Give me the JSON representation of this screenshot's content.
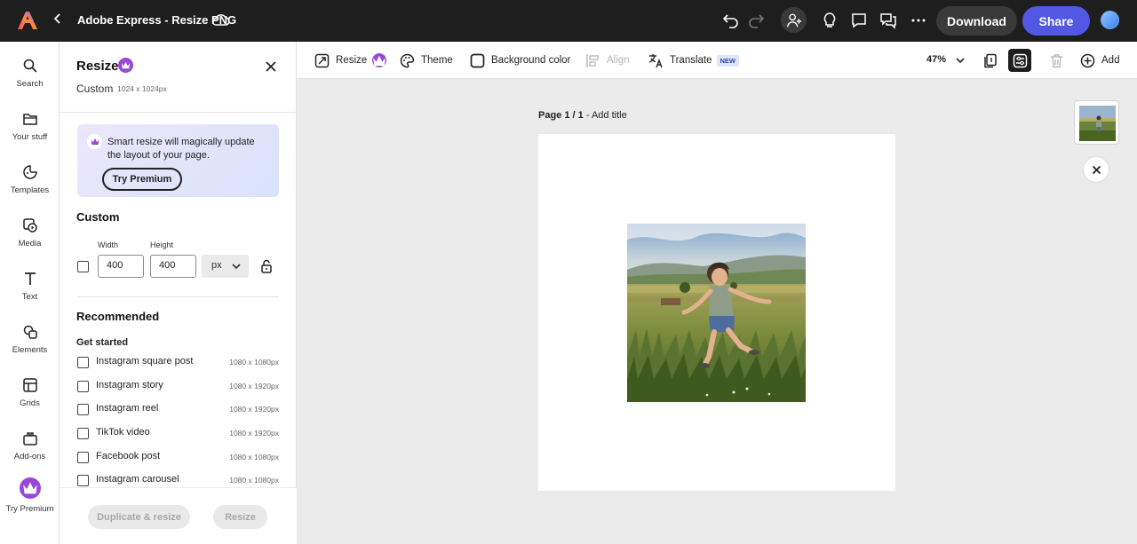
{
  "app": {
    "doc_title": "Adobe Express - Resize PNG",
    "download_label": "Download",
    "share_label": "Share",
    "brand_color": "#5258e4"
  },
  "rail": {
    "items": [
      {
        "label": "Search",
        "icon": "search-icon"
      },
      {
        "label": "Your stuff",
        "icon": "folder-icon"
      },
      {
        "label": "Templates",
        "icon": "templates-icon"
      },
      {
        "label": "Media",
        "icon": "media-icon"
      },
      {
        "label": "Text",
        "icon": "text-icon"
      },
      {
        "label": "Elements",
        "icon": "elements-icon"
      },
      {
        "label": "Grids",
        "icon": "grid-icon"
      },
      {
        "label": "Add-ons",
        "icon": "addons-icon"
      },
      {
        "label": "Try Premium",
        "icon": "crown-icon"
      }
    ]
  },
  "panel": {
    "title": "Resize",
    "current_preset": "Custom",
    "current_size": "1024 x 1024px",
    "promo_text": "Smart resize will magically update the layout of your page.",
    "promo_button": "Try Premium",
    "custom_heading": "Custom",
    "width_label": "Width",
    "height_label": "Height",
    "width_value": "400",
    "height_value": "400",
    "unit": "px",
    "recommended_heading": "Recommended",
    "get_started_heading": "Get started",
    "presets": [
      {
        "name": "Instagram square post",
        "size": "1080 x 1080px"
      },
      {
        "name": "Instagram story",
        "size": "1080 x 1920px"
      },
      {
        "name": "Instagram reel",
        "size": "1080 x 1920px"
      },
      {
        "name": "TikTok video",
        "size": "1080 x 1920px"
      },
      {
        "name": "Facebook post",
        "size": "1080 x 1080px"
      },
      {
        "name": "Instagram carousel",
        "size": "1080 x 1080px"
      }
    ],
    "duplicate_resize_label": "Duplicate & resize",
    "resize_label": "Resize"
  },
  "toolbar": {
    "resize_label": "Resize",
    "theme_label": "Theme",
    "background_label": "Background color",
    "align_label": "Align",
    "translate_label": "Translate",
    "new_tag": "NEW",
    "zoom": "47%",
    "add_label": "Add"
  },
  "canvas": {
    "page_number": "Page 1 / 1",
    "separator": " - ",
    "add_title": "Add title"
  }
}
